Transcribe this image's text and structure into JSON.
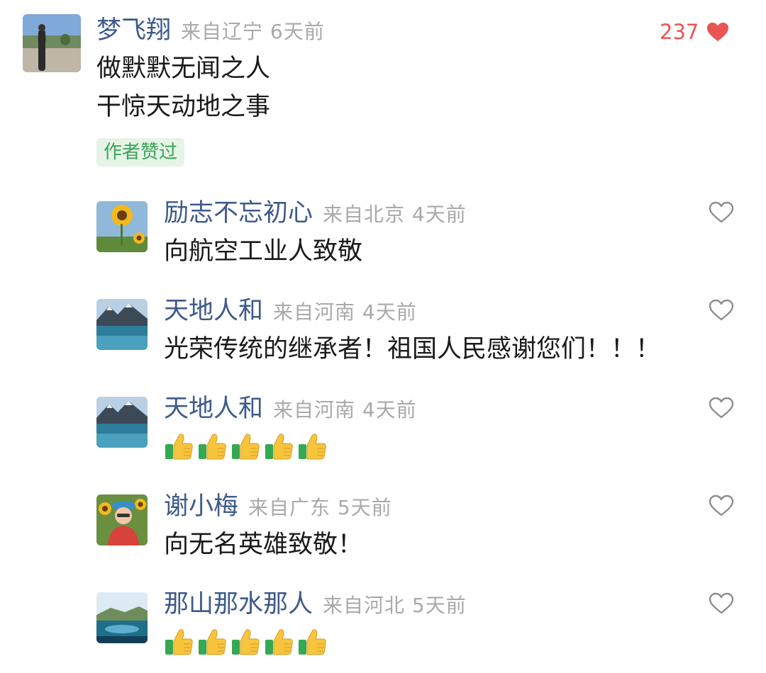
{
  "top_comment": {
    "username": "梦飞翔",
    "meta": "来自辽宁 6天前",
    "lines": [
      "做默默无闻之人",
      "干惊天动地之事"
    ],
    "like_count": "237",
    "badge": "作者赞过"
  },
  "replies": [
    {
      "username": "励志不忘初心",
      "meta": "来自北京 4天前",
      "text": "向航空工业人致敬"
    },
    {
      "username": "天地人和",
      "meta": "来自河南 4天前",
      "text": "光荣传统的继承者！祖国人民感谢您们！！！"
    },
    {
      "username": "天地人和",
      "meta": "来自河南 4天前",
      "text": "",
      "emoji": "thumbs-up-x5"
    },
    {
      "username": "谢小梅",
      "meta": "来自广东 5天前",
      "text": "向无名英雄致敬！"
    },
    {
      "username": "那山那水那人",
      "meta": "来自河北 5天前",
      "text": "",
      "emoji": "thumbs-up-x5"
    }
  ],
  "colors": {
    "username": "#3d5a8a",
    "meta": "#a9a9a9",
    "like_red": "#e95550",
    "badge_bg": "#e6f4e7",
    "badge_text": "#3aa356"
  }
}
